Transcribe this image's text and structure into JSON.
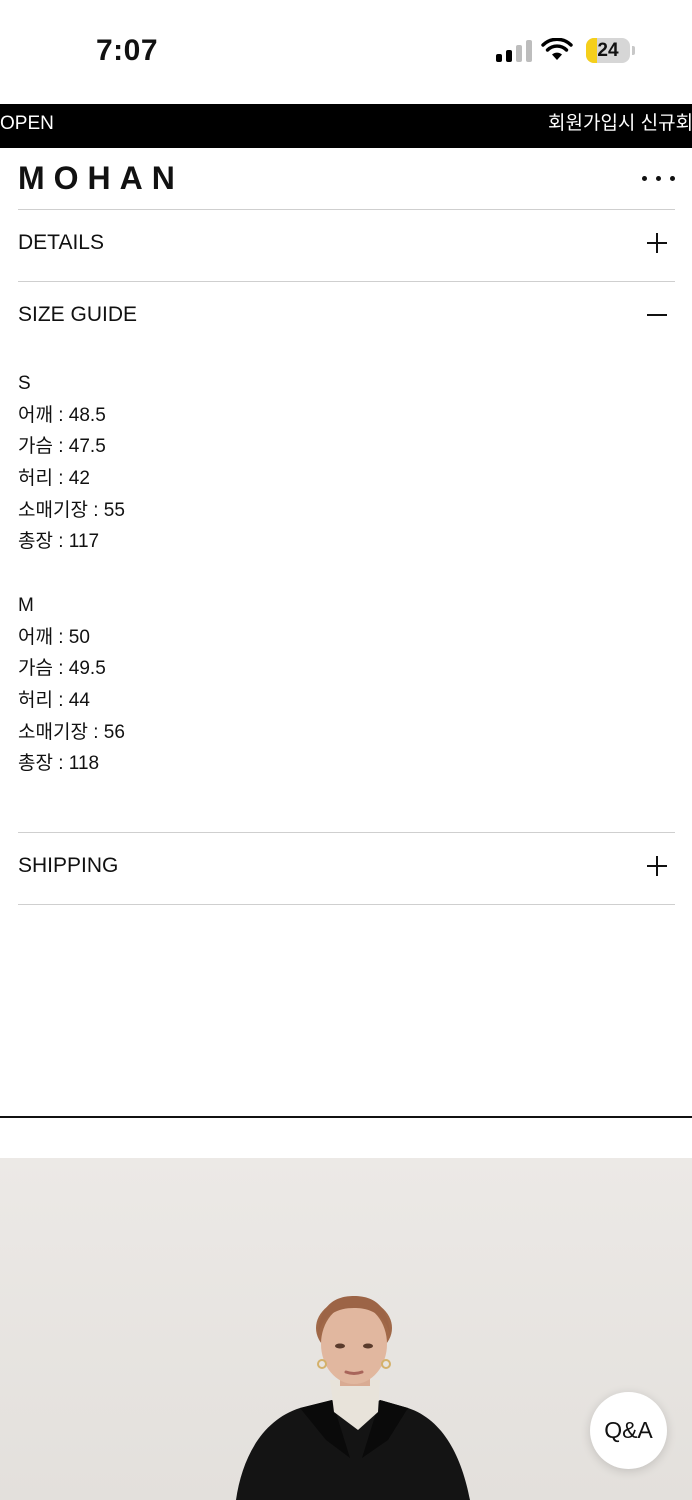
{
  "status_bar": {
    "time": "7:07",
    "battery": "24",
    "battery_level": 0.24
  },
  "banner": {
    "left_text": "OPEN",
    "right_text": "회원가입시 신규회원"
  },
  "header": {
    "brand": "MOHAN"
  },
  "accordion": {
    "details": {
      "title": "DETAILS",
      "state": "collapsed"
    },
    "size_guide": {
      "title": "SIZE GUIDE",
      "state": "expanded",
      "sizes": [
        {
          "size": "S",
          "lines": [
            "어깨 : 48.5",
            "가슴 : 47.5",
            "허리 : 42",
            "소매기장 : 55",
            "총장 : 117"
          ]
        },
        {
          "size": "M",
          "lines": [
            "어깨 : 50",
            "가슴 : 49.5",
            "허리 : 44",
            "소매기장 : 56",
            "총장 : 118"
          ]
        }
      ]
    },
    "shipping": {
      "title": "SHIPPING",
      "state": "collapsed"
    }
  },
  "floating": {
    "qa_label": "Q&A"
  },
  "colors": {
    "banner_bg": "#000000",
    "battery_fill": "#f5cf1b",
    "divider": "#cfcfcf"
  }
}
